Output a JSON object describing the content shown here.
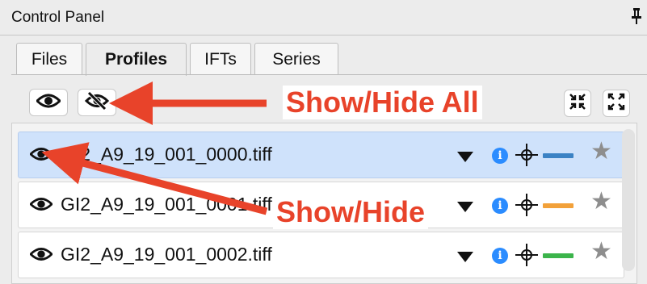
{
  "titlebar": {
    "title": "Control Panel",
    "pin_icon": "pin-icon"
  },
  "tabs": [
    {
      "label": "Files",
      "active": false
    },
    {
      "label": "Profiles",
      "active": true
    },
    {
      "label": "IFTs",
      "active": false
    },
    {
      "label": "Series",
      "active": false
    }
  ],
  "toolbar": {
    "show_all_icon": "eye-icon",
    "hide_all_icon": "eye-slash-icon",
    "collapse_icon": "collapse-icon",
    "expand_icon": "expand-icon"
  },
  "profiles": [
    {
      "filename": "GI2_A9_19_001_0000.tiff",
      "selected": true,
      "line_color": "#3b82c4"
    },
    {
      "filename": "GI2_A9_19_001_0001.tiff",
      "selected": false,
      "line_color": "#f2a13a"
    },
    {
      "filename": "GI2_A9_19_001_0002.tiff",
      "selected": false,
      "line_color": "#3cb44b"
    }
  ],
  "annotations": {
    "show_hide_all": "Show/Hide All",
    "show_hide": "Show/Hide",
    "color": "#e8432a"
  }
}
